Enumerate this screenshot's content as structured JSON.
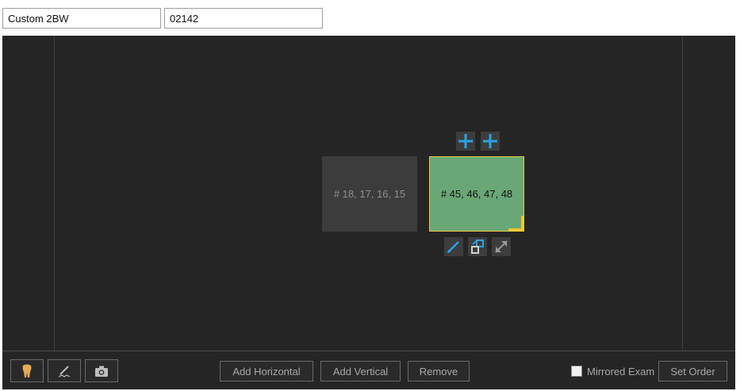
{
  "header": {
    "name_value": "Custom 2BW",
    "code_value": "02142"
  },
  "canvas": {
    "slots": [
      {
        "label": "# 18, 17, 16, 15",
        "selected": false
      },
      {
        "label": "# 45, 46, 47, 48",
        "selected": true
      }
    ]
  },
  "icons": {
    "add_left": "plus-icon",
    "add_right": "plus-icon",
    "edit": "pencil-icon",
    "swap": "swap-icon",
    "expand": "expand-icon",
    "tooth": "tooth-icon",
    "sign": "signature-icon",
    "camera": "camera-icon"
  },
  "toolbar": {
    "add_horizontal": "Add Horizontal",
    "add_vertical": "Add Vertical",
    "remove": "Remove",
    "mirrored_exam": "Mirrored Exam",
    "mirrored_checked": false,
    "set_order": "Set Order"
  },
  "colors": {
    "background": "#252525",
    "slot_gray": "#3c3c3c",
    "slot_selected": "#6aa776",
    "selection_border": "#e8c840",
    "accent_blue": "#29a3e8"
  }
}
